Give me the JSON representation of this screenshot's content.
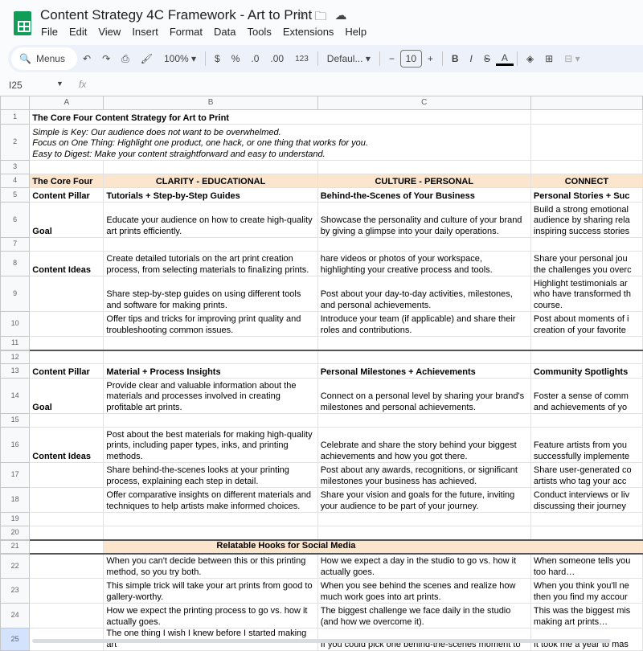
{
  "app": {
    "title": "Content Strategy 4C Framework - Art to Print",
    "menu": [
      "File",
      "Edit",
      "View",
      "Insert",
      "Format",
      "Data",
      "Tools",
      "Extensions",
      "Help"
    ],
    "toolbar": {
      "search": "Menus",
      "zoom": "100%",
      "currency": "$",
      "percent": "%",
      "dec_less": ".0",
      "dec_more": ".00",
      "format123": "123",
      "font": "Defaul...",
      "font_size": "10",
      "bold": "B",
      "italic": "I",
      "strike": "S",
      "text_color": "A"
    },
    "name_box": "I25",
    "fx": "fx"
  },
  "columns": [
    "A",
    "B",
    "C"
  ],
  "rows": [
    {
      "n": "1",
      "cells": [
        "The Core Four Content Strategy for Art to Print",
        "",
        "",
        ""
      ],
      "style": "title"
    },
    {
      "n": "2",
      "cells": [
        "Simple is Key: Our audience does not want to be overwhelmed.\nFocus on One Thing: Highlight one product, one hack, or one thing that works for you.\nEasy to Digest: Make your content straightforward and easy to understand.",
        "",
        "",
        ""
      ],
      "style": "intro"
    },
    {
      "n": "3",
      "cells": [
        "",
        "",
        "",
        ""
      ]
    },
    {
      "n": "4",
      "cells": [
        "The Core Four",
        "CLARITY - EDUCATIONAL",
        "CULTURE - PERSONAL",
        "CONNECT"
      ],
      "style": "head"
    },
    {
      "n": "5",
      "cells": [
        "Content Pillar",
        "Tutorials + Step-by-Step Guides",
        "Behind-the-Scenes of Your Business",
        "Personal Stories + Suc"
      ],
      "style": "bold"
    },
    {
      "n": "6",
      "cells": [
        "Goal",
        "Educate your audience on how to create high-quality art prints efficiently.",
        "Showcase the personality and culture of your brand by giving a glimpse into your daily operations.",
        "Build a strong emotional\naudience by sharing rela\ninspiring success stories"
      ],
      "style": "firstbold"
    },
    {
      "n": "7",
      "cells": [
        "",
        "",
        "",
        ""
      ]
    },
    {
      "n": "8",
      "cells": [
        "Content Ideas",
        "Create detailed tutorials on the art print creation process, from selecting materials to finalizing prints.",
        "hare videos or photos of your workspace, highlighting your creative process and tools.",
        "Share your personal jou\nthe challenges you overc"
      ],
      "style": "firstbold"
    },
    {
      "n": "9",
      "cells": [
        "",
        "Share step-by-step guides on using different tools and software for making prints.",
        "Post about your day-to-day activities, milestones, and personal achievements.",
        "Highlight testimonials ar\nwho have transformed th\ncourse."
      ]
    },
    {
      "n": "10",
      "cells": [
        "",
        "Offer tips and tricks for improving print quality and troubleshooting common issues.",
        "Introduce your team (if applicable) and share their roles and contributions.",
        "Post about moments of i\ncreation of your favorite"
      ]
    },
    {
      "n": "11",
      "cells": [
        "",
        "",
        "",
        ""
      ]
    },
    {
      "n": "12",
      "cells": [
        "",
        "",
        "",
        ""
      ],
      "style": "thick"
    },
    {
      "n": "13",
      "cells": [
        "Content Pillar",
        "Material + Process Insights",
        "Personal Milestones + Achievements",
        "Community Spotlights"
      ],
      "style": "bold"
    },
    {
      "n": "14",
      "cells": [
        "Goal",
        "Provide clear and valuable information about the materials and processes involved in creating profitable art prints.",
        "Connect on a personal level by sharing your brand's milestones and personal achievements.",
        "Foster a sense of comm\nand achievements of yo"
      ],
      "style": "firstbold"
    },
    {
      "n": "15",
      "cells": [
        "",
        "",
        "",
        ""
      ]
    },
    {
      "n": "16",
      "cells": [
        "Content Ideas",
        "Post about the best materials for making high-quality prints, including paper types, inks, and printing methods.",
        "Celebrate and share the story behind your biggest achievements and how you got there.",
        "Feature artists from you\nsuccessfully implemente"
      ],
      "style": "firstbold"
    },
    {
      "n": "17",
      "cells": [
        "",
        "Share behind-the-scenes looks at your printing process, explaining each step in detail.",
        "Post about any awards, recognitions, or significant milestones your business has achieved.",
        "Share user-generated co\nartists who tag your acc"
      ]
    },
    {
      "n": "18",
      "cells": [
        "",
        "Offer comparative insights on different materials and techniques to help artists make informed choices.",
        "Share your vision and goals for the future, inviting your audience to be part of your journey.",
        "Conduct interviews or liv\ndiscussing their journey"
      ]
    },
    {
      "n": "19",
      "cells": [
        "",
        "",
        "",
        ""
      ]
    },
    {
      "n": "20",
      "cells": [
        "",
        "",
        "",
        ""
      ]
    },
    {
      "n": "21",
      "cells": [
        "",
        "Relatable Hooks for Social Media",
        "",
        ""
      ],
      "style": "hooks"
    },
    {
      "n": "22",
      "cells": [
        "",
        "When you can't decide between this or this printing method, so you try both.",
        "How we expect a day in the studio to go vs. how it actually goes.",
        "When someone tells you\ntoo hard…"
      ]
    },
    {
      "n": "23",
      "cells": [
        "",
        "This simple trick will take your art prints from good to gallery-worthy.",
        "When you see behind the scenes and realize how much work goes into art prints.",
        "When you think you'll ne\nthen you find my accour"
      ]
    },
    {
      "n": "24",
      "cells": [
        "",
        "How we expect the printing process to go vs. how it actually goes.",
        "The biggest challenge we face daily in the studio (and how we overcome it).",
        "This was the biggest mis\nmaking art prints…"
      ]
    },
    {
      "n": "25",
      "cells": [
        "",
        "The one thing I wish I knew before I started making art",
        "If you could pick one behind-the-scenes moment to",
        "It took me a year to mas"
      ]
    }
  ],
  "colors": {
    "header_fill": "#fce5cd",
    "brand": "#0f9d58"
  }
}
